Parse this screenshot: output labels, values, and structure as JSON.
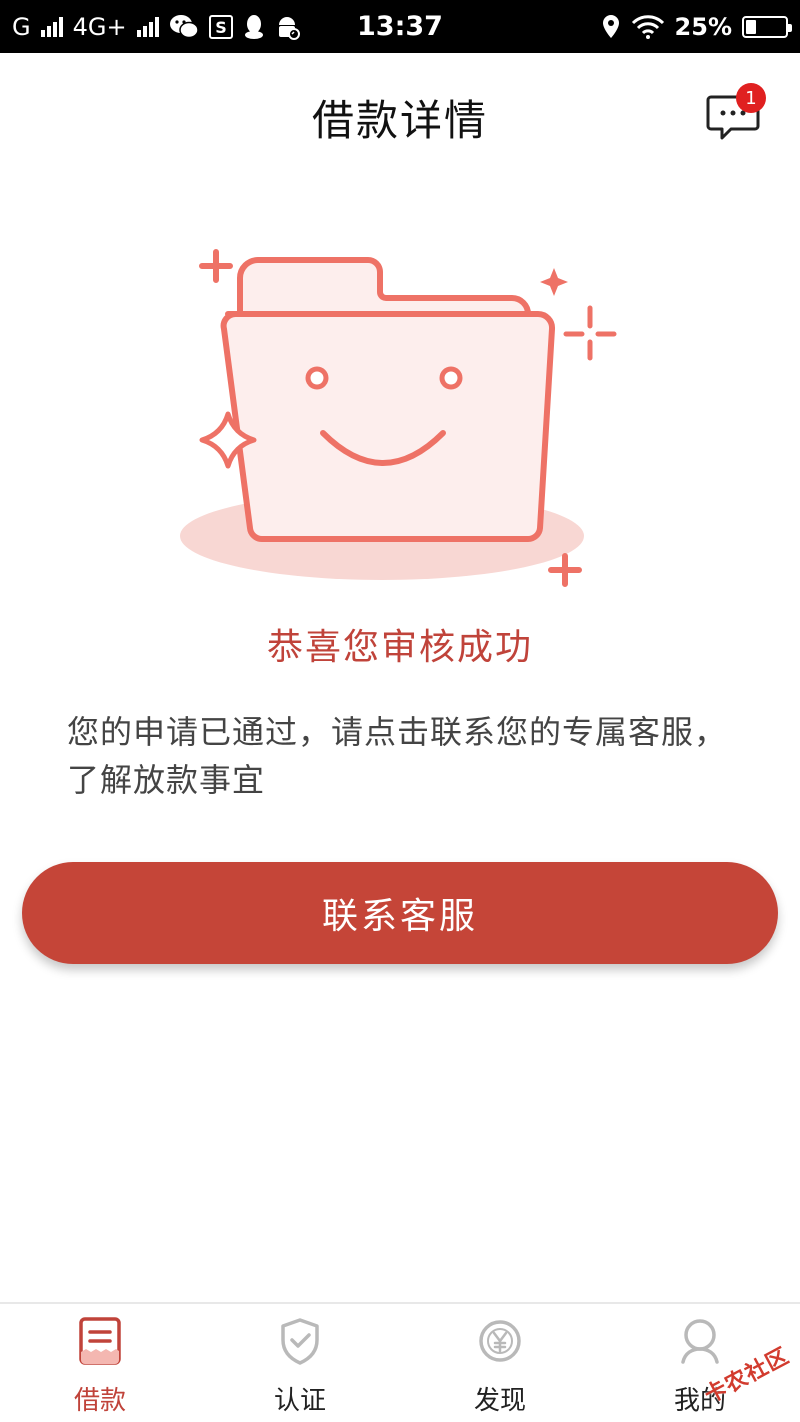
{
  "status_bar": {
    "carrier_1": "G",
    "carrier_2": "4G+",
    "time": "13:37",
    "battery": "25%",
    "battery_level": 0.25,
    "icons": [
      "signal-icon",
      "wechat-icon",
      "s-app-icon",
      "qq-icon",
      "android-icon",
      "location-icon",
      "wifi-icon",
      "battery-icon"
    ]
  },
  "header": {
    "title": "借款详情",
    "message_badge": "1"
  },
  "content": {
    "success_title": "恭喜您审核成功",
    "success_desc": "您的申请已通过，请点击联系您的专属客服，了解放款事宜"
  },
  "actions": {
    "contact_label": "联系客服"
  },
  "bottom_nav": {
    "items": [
      {
        "label": "借款",
        "icon": "loan-icon",
        "active": true
      },
      {
        "label": "认证",
        "icon": "shield-check-icon",
        "active": false
      },
      {
        "label": "发现",
        "icon": "yuan-coin-icon",
        "active": false
      },
      {
        "label": "我的",
        "icon": "user-icon",
        "active": false
      }
    ]
  },
  "watermark": "卡农社区",
  "colors": {
    "accent": "#c54538",
    "title_red": "#c0433a",
    "illustration_stroke": "#ee7266",
    "illustration_fill": "#fdeeed",
    "badge": "#e02020"
  }
}
